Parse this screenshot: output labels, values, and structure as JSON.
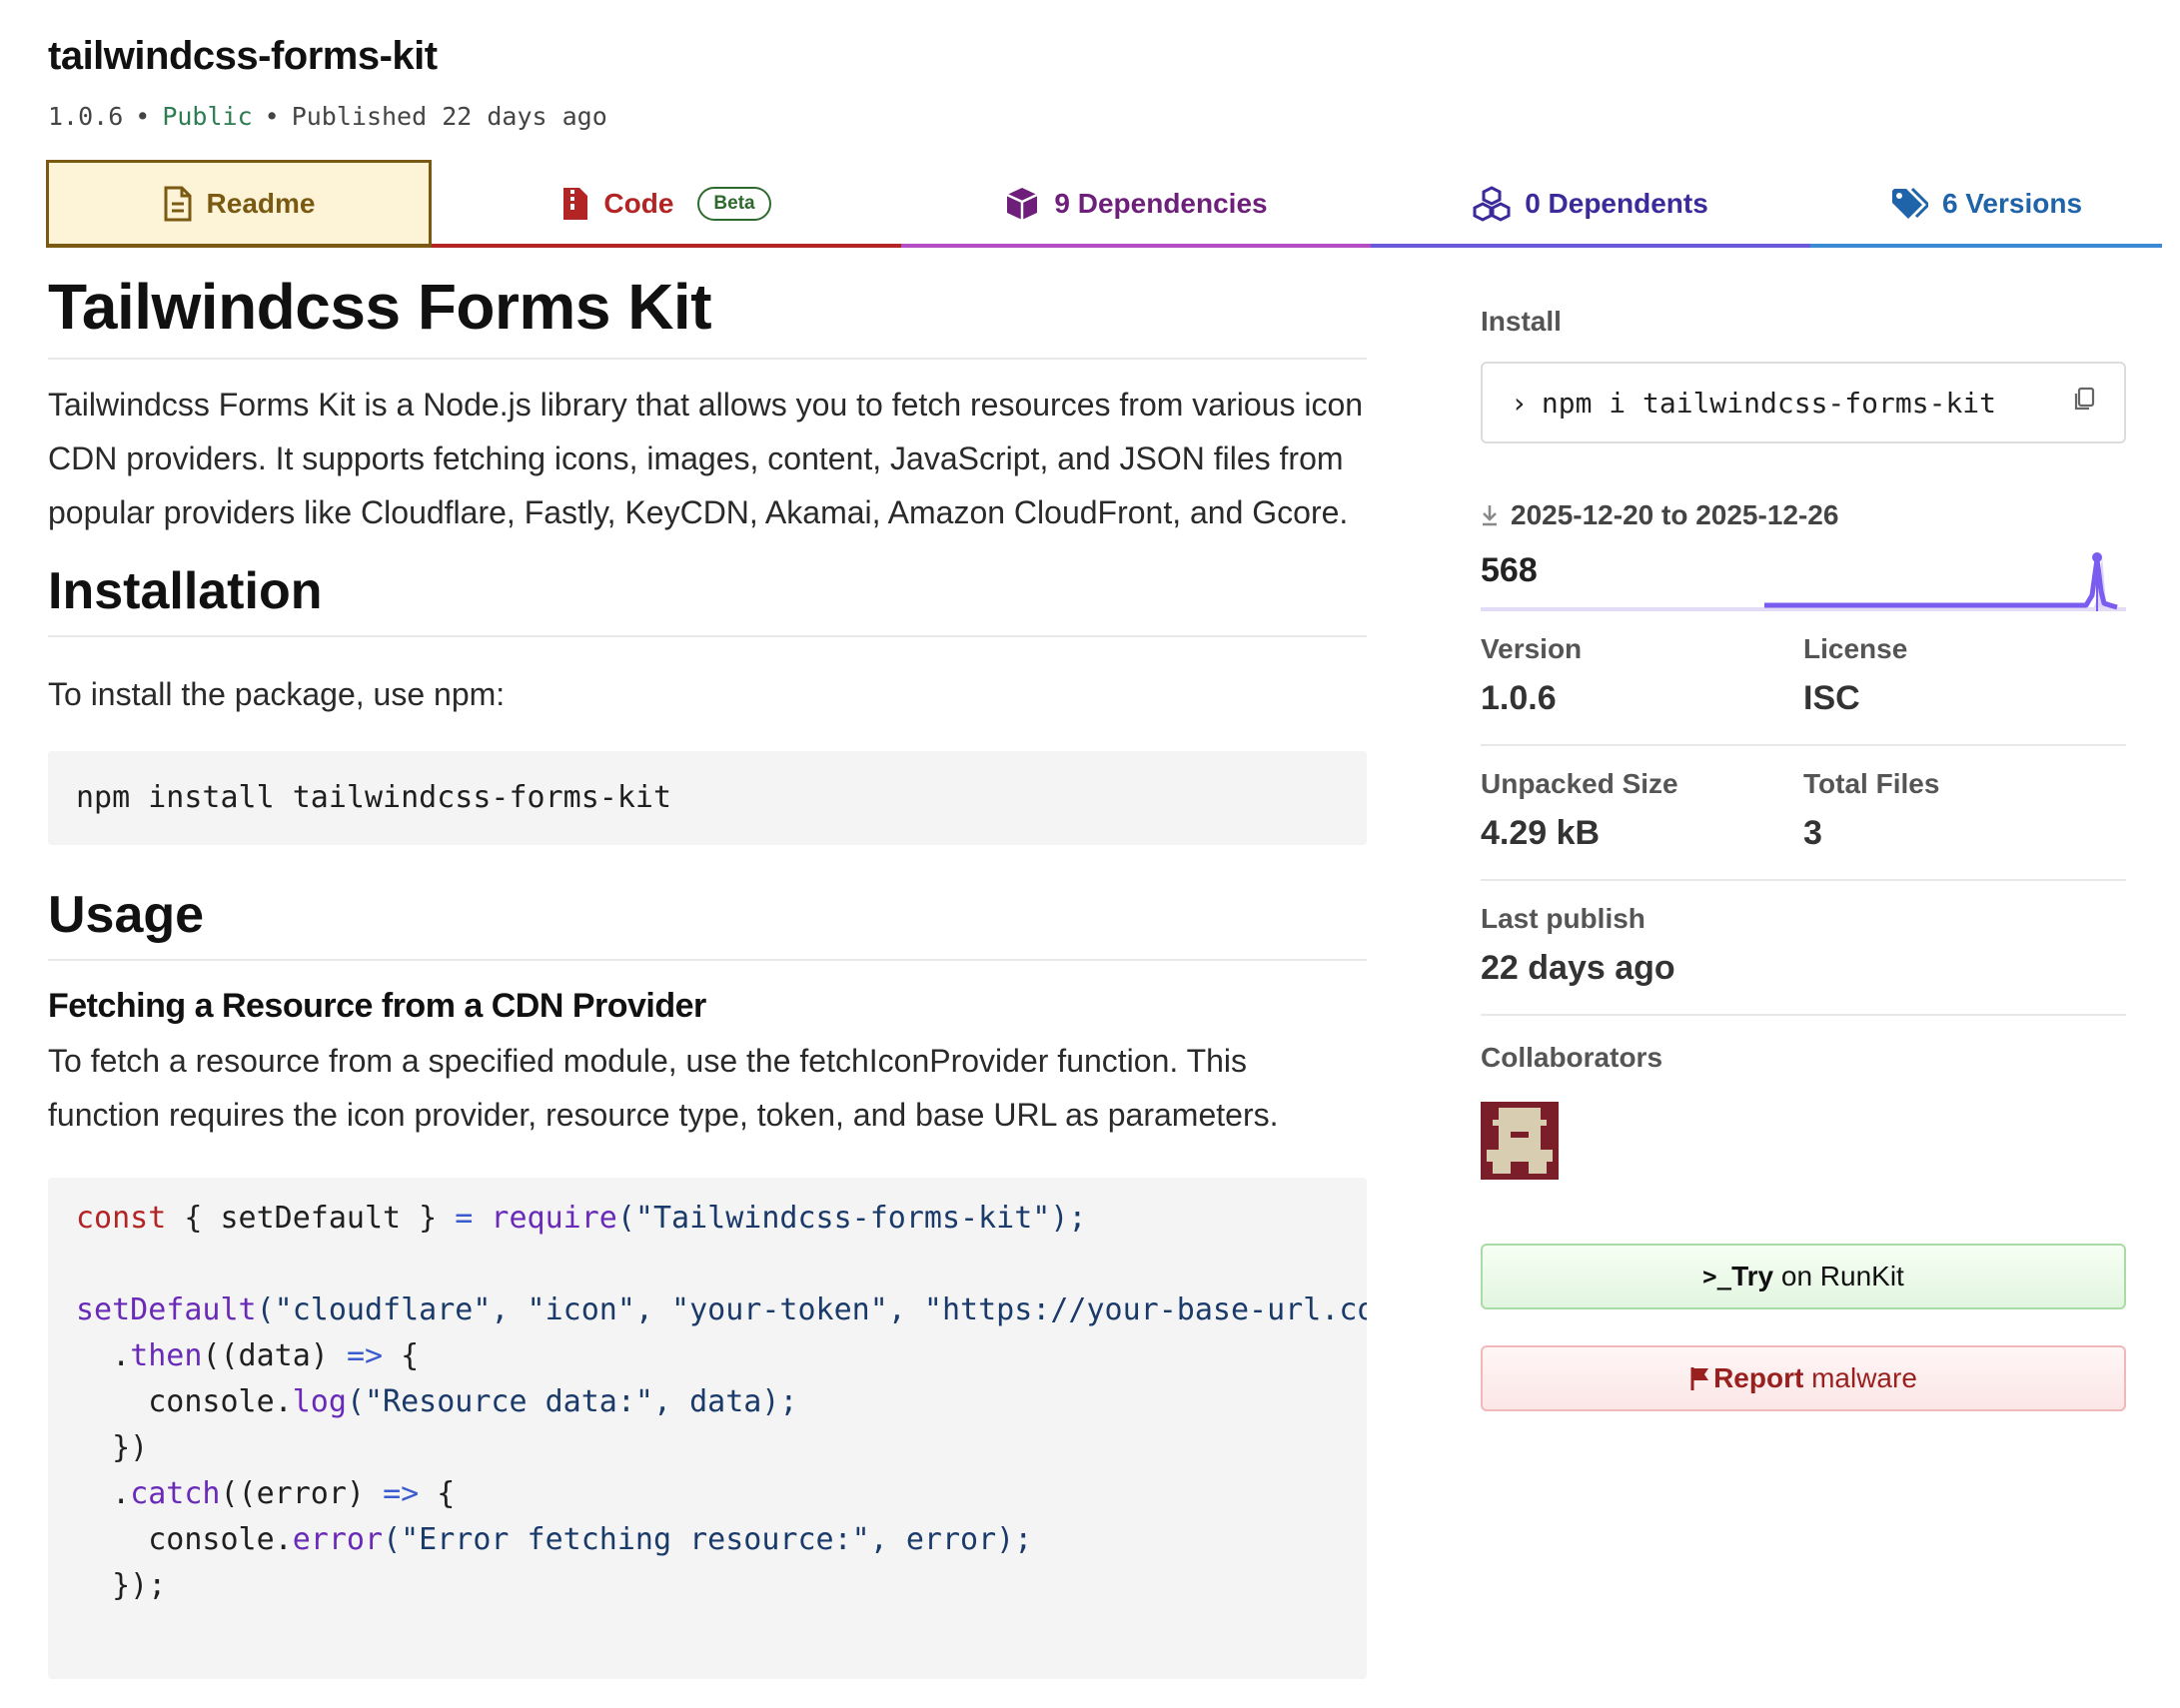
{
  "package": {
    "name": "tailwindcss-forms-kit",
    "version": "1.0.6",
    "visibility": "Public",
    "published": "Published 22 days ago",
    "separator": "•"
  },
  "tabs": {
    "readme": "Readme",
    "code": "Code",
    "code_badge": "Beta",
    "dependencies": "9 Dependencies",
    "dependents": "0 Dependents",
    "versions": "6 Versions"
  },
  "readme": {
    "title": "Tailwindcss Forms Kit",
    "intro": "Tailwindcss Forms Kit is a Node.js library that allows you to fetch resources from various icon CDN providers. It supports fetching icons, images, content, JavaScript, and JSON files from popular providers like Cloudflare, Fastly, KeyCDN, Akamai, Amazon CloudFront, and Gcore.",
    "installation_heading": "Installation",
    "installation_text": "To install the package, use npm:",
    "install_code": "npm install tailwindcss-forms-kit",
    "usage_heading": "Usage",
    "usage_subheading": "Fetching a Resource from a CDN Provider",
    "usage_text": "To fetch a resource from a specified module, use the fetchIconProvider function. This function requires the icon provider, resource type, token, and base URL as parameters.",
    "usage_code": {
      "l1_kw": "const",
      "l1_a": " { setDefault } ",
      "l1_op": "=",
      "l1_sp": " ",
      "l1_fn": "require",
      "l1_str": "(\"Tailwindcss-forms-kit\");",
      "l3_fn": "setDefault",
      "l3_str": "(\"cloudflare\", \"icon\", \"your-token\", \"https://your-base-url.com\"",
      "l4_a": "  .",
      "l4_fn": "then",
      "l4_b": "((data) ",
      "l4_op": "=>",
      "l4_c": " {",
      "l5_a": "    console.",
      "l5_fn": "log",
      "l5_str": "(\"Resource data:\", data);",
      "l6": "  })",
      "l7_a": "  .",
      "l7_fn": "catch",
      "l7_b": "((error) ",
      "l7_op": "=>",
      "l7_c": " {",
      "l8_a": "    console.",
      "l8_fn": "error",
      "l8_str": "(\"Error fetching resource:\", error);",
      "l9": "  });"
    }
  },
  "sidebar": {
    "install_label": "Install",
    "install_prompt": "›",
    "install_cmd": "npm i tailwindcss-forms-kit",
    "downloads_range": "2025-12-20 to 2025-12-26",
    "downloads_count": "568",
    "version_label": "Version",
    "version_value": "1.0.6",
    "license_label": "License",
    "license_value": "ISC",
    "unpacked_label": "Unpacked Size",
    "unpacked_value": "4.29 kB",
    "files_label": "Total Files",
    "files_value": "3",
    "last_publish_label": "Last publish",
    "last_publish_value": "22 days ago",
    "collaborators_label": "Collaborators",
    "runkit_prefix": ">_",
    "runkit_bold": "Try",
    "runkit_rest": " on RunKit",
    "report_bold": "Report",
    "report_rest": " malware"
  },
  "colors": {
    "readme_tab": "#7a5a12",
    "code_tab": "#b32424",
    "deps_tab": "#6d1f7a",
    "dependents_tab": "#3a2a9b",
    "versions_tab": "#1f63a8",
    "sparkline": "#7b5cf0",
    "public": "#2e7d52"
  },
  "icons": {
    "readme": "document-icon",
    "code": "zip-file-icon",
    "dependencies": "box-icon",
    "dependents": "boxes-icon",
    "versions": "tags-icon",
    "copy": "copy-icon",
    "download": "download-icon",
    "report": "flag-icon"
  }
}
